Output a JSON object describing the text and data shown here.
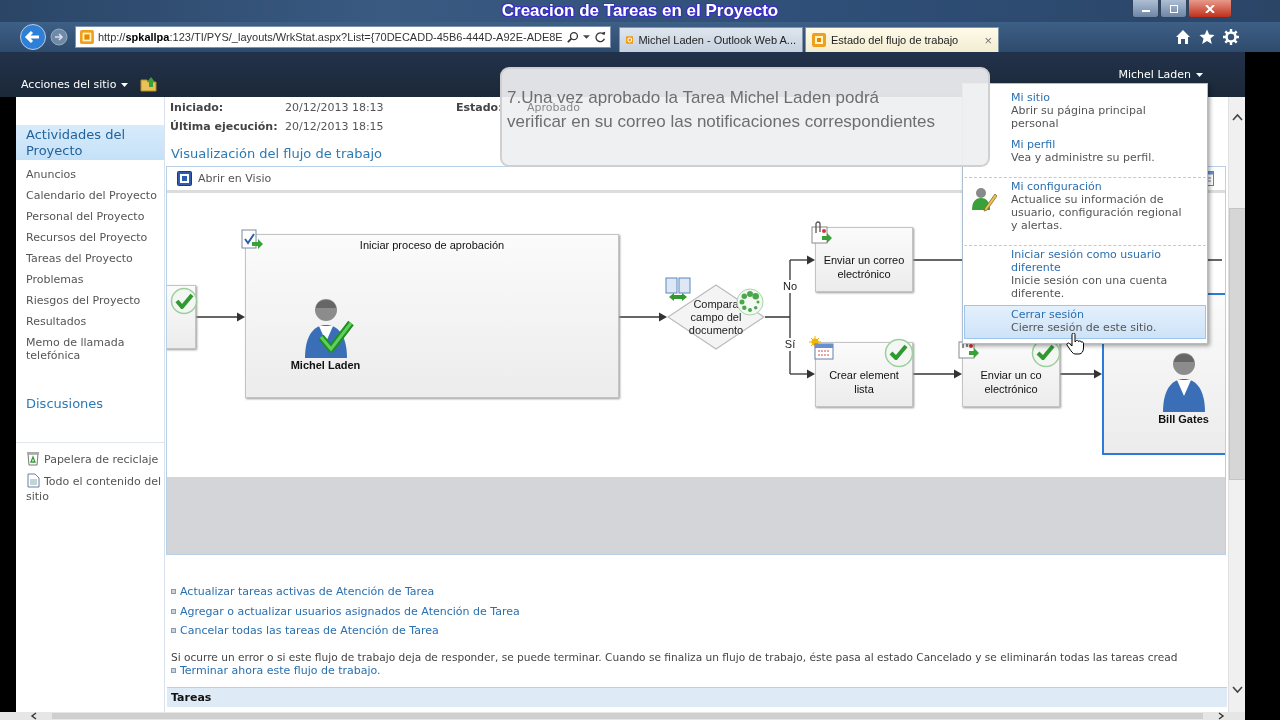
{
  "window": {
    "title": "Creacion de Tareas en el Proyecto"
  },
  "browser": {
    "address": "http://**spkallpa**:123/TI/PYS/_layouts/WrkStat.aspx?List={70DECADD-45B6-444D-A92E-ADE8E",
    "tabs": [
      {
        "label": "Michel Laden - Outlook Web A...",
        "selected": false
      },
      {
        "label": "Estado del flujo de trabajo",
        "selected": true,
        "close": "×"
      }
    ]
  },
  "ribbon": {
    "site_actions": "Acciones del sitio",
    "user": "Michel Laden"
  },
  "sidebar": {
    "sections": [
      {
        "heading": "Actividades del Proyecto",
        "selected": true,
        "items": [
          "Anuncios",
          "Calendario del Proyecto",
          "Personal del Proyecto",
          "Recursos del Proyecto",
          "Tareas del Proyecto",
          "Problemas",
          "Riesgos del Proyecto",
          "Resultados",
          "Memo de llamada telefónica"
        ]
      },
      {
        "heading": "Discusiones",
        "selected": false
      }
    ],
    "footer": [
      {
        "kind": "recycle-bin",
        "label": "Papelera de reciclaje"
      },
      {
        "kind": "site-content",
        "label": "Todo el contenido del sitio"
      }
    ]
  },
  "status": {
    "fields": [
      {
        "label": "Iniciado:",
        "value": "20/12/2013 18:13"
      },
      {
        "label": "Última ejecución:",
        "value": "20/12/2013 18:15"
      }
    ],
    "state": {
      "label": "Estado:",
      "value": "Aprobado"
    }
  },
  "tooltip": "7.Una vez aprobado la Tarea Michel Laden podrá\nverificar en su correo las notificaciones correspondientes",
  "visualization": {
    "heading": "Visualización del flujo de trabajo",
    "toolbar_action": "Abrir en Visio",
    "nodes": [
      {
        "kind": "step",
        "done": true
      },
      {
        "kind": "task",
        "title": "Iniciar proceso de aprobación",
        "assignee": "Michel Laden",
        "done": true,
        "selected": false
      },
      {
        "kind": "condition",
        "label": "Compara\ncampo del\ndocumento",
        "running": true
      },
      {
        "kind": "email",
        "label": "Enviar un correo\nelectrónico",
        "done": false
      },
      {
        "kind": "list-item",
        "label": "Crear element\nlista",
        "done": true
      },
      {
        "kind": "email",
        "label": "Enviar un co\nelectrónico",
        "done": true
      },
      {
        "kind": "task",
        "assignee": "Bill Gates",
        "done": false,
        "selected": true
      }
    ],
    "branches": [
      "No",
      "Sí"
    ]
  },
  "links": [
    "Actualizar tareas activas de Atención de Tarea",
    "Agregar o actualizar usuarios asignados de Atención de Tarea",
    "Cancelar todas las tareas de Atención de Tarea"
  ],
  "terminate": {
    "note": "Si ocurre un error o si este flujo de trabajo deja de responder, se puede terminar. Cuando se finaliza un flujo de trabajo, éste pasa al estado Cancelado y se eliminarán todas las tareas cread",
    "link": "Terminar ahora este flujo de trabajo."
  },
  "tasks": {
    "heading": "Tareas"
  },
  "user_menu": {
    "items": [
      {
        "kind": "plain",
        "title": "Mi sitio",
        "description": "Abrir su página principal personal",
        "separator_before": false,
        "hovered": false
      },
      {
        "kind": "plain",
        "title": "Mi perfil",
        "description": "Vea y administre su perfil.",
        "separator_before": false,
        "hovered": false
      },
      {
        "kind": "icon",
        "title": "Mi configuración",
        "description": "Actualice su información de usuario, configuración regional y alertas.",
        "separator_before": true,
        "hovered": false
      },
      {
        "kind": "plain",
        "title": "Iniciar sesión como usuario diferente",
        "description": "Inicie sesión con una cuenta diferente.",
        "separator_before": true,
        "hovered": false
      },
      {
        "kind": "plain",
        "title": "Cerrar sesión",
        "description": "Cierre sesión de este sitio.",
        "separator_before": false,
        "hovered": true
      }
    ]
  }
}
